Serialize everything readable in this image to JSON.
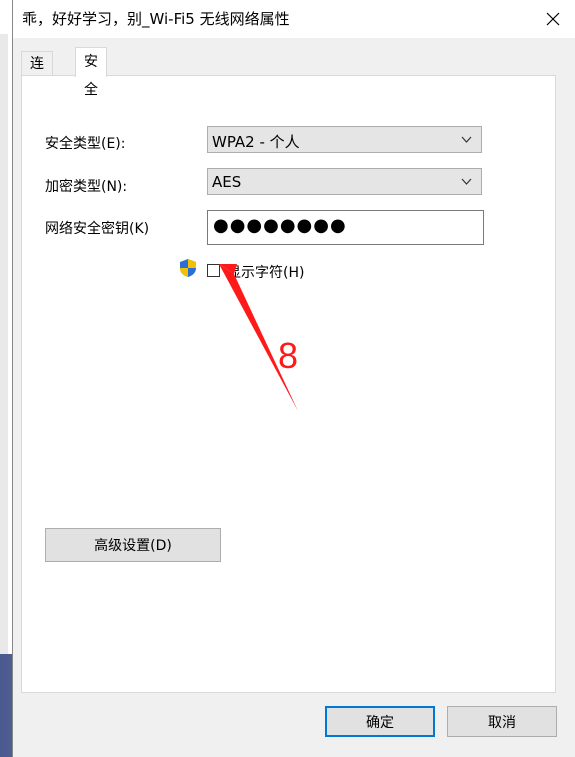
{
  "window": {
    "title": "乖，好好学习，别_Wi-Fi5 无线网络属性"
  },
  "tabs": [
    {
      "label": "连接"
    },
    {
      "label": "安全"
    }
  ],
  "security": {
    "security_type_label": "安全类型(E):",
    "security_type_value": "WPA2 - 个人",
    "encryption_type_label": "加密类型(N):",
    "encryption_type_value": "AES",
    "key_label": "网络安全密钥(K)",
    "key_value": "●●●●●●●●",
    "show_chars_label": "显示字符(H)",
    "show_chars_checked": false
  },
  "annotation": {
    "number": "8",
    "color": "#ff1a1a"
  },
  "buttons": {
    "advanced": "高级设置(D)",
    "ok": "确定",
    "cancel": "取消"
  },
  "icons": {
    "close": "close-icon",
    "shield": "uac-shield-icon",
    "dropdown": "chevron-down-icon"
  }
}
